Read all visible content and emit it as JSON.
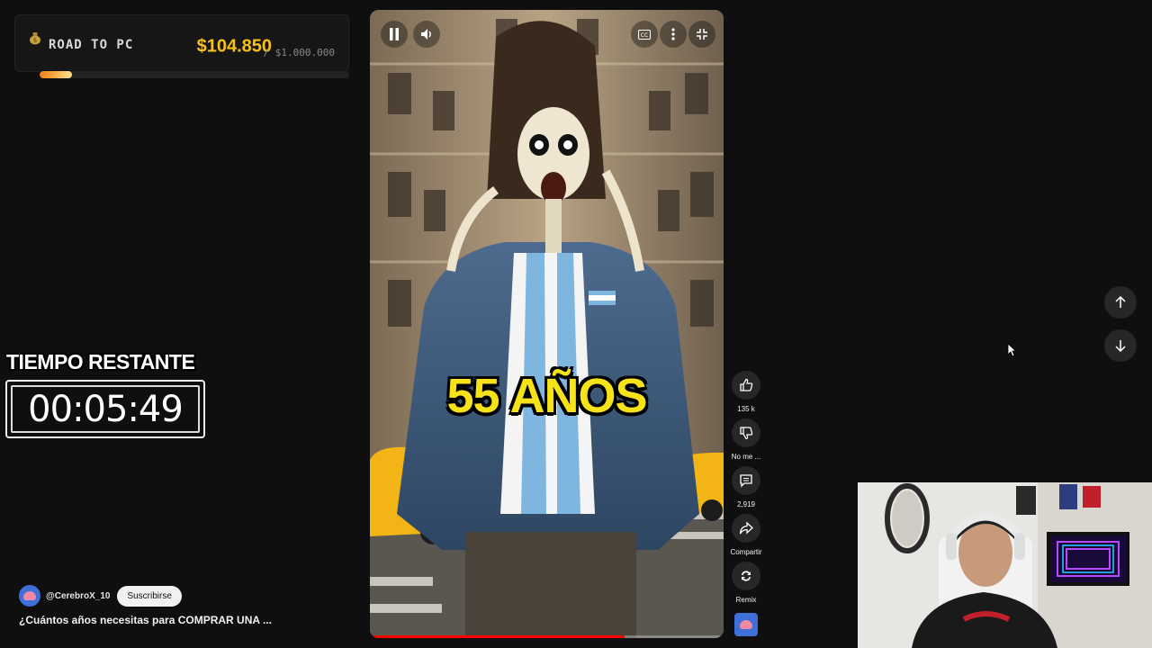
{
  "goal": {
    "title": "ROAD TO PC",
    "current": "$104.850",
    "target": "/ $1.000.000",
    "progress": 0.1049,
    "icon": "money-bag-icon"
  },
  "timer": {
    "label": "TIEMPO RESTANTE",
    "value": "00:05:49"
  },
  "channel": {
    "handle": "@CerebroX_10",
    "subscribe_label": "Suscribirse"
  },
  "video": {
    "title": "¿Cuántos años necesitas para COMPRAR UNA ...",
    "overlay_text": "55 AÑOS",
    "progress": 0.72,
    "controls": [
      "pause-icon",
      "volume-icon",
      "captions-icon",
      "more-icon",
      "exit-fullscreen-icon"
    ]
  },
  "actions": {
    "like_count": "135 k",
    "dislike_label": "No me ...",
    "comments_count": "2,919",
    "share_label": "Compartir",
    "remix_label": "Remix"
  },
  "colors": {
    "accent_gold": "#f5c018",
    "progress_red": "#ff0000",
    "overlay_yellow": "#f6e219"
  }
}
